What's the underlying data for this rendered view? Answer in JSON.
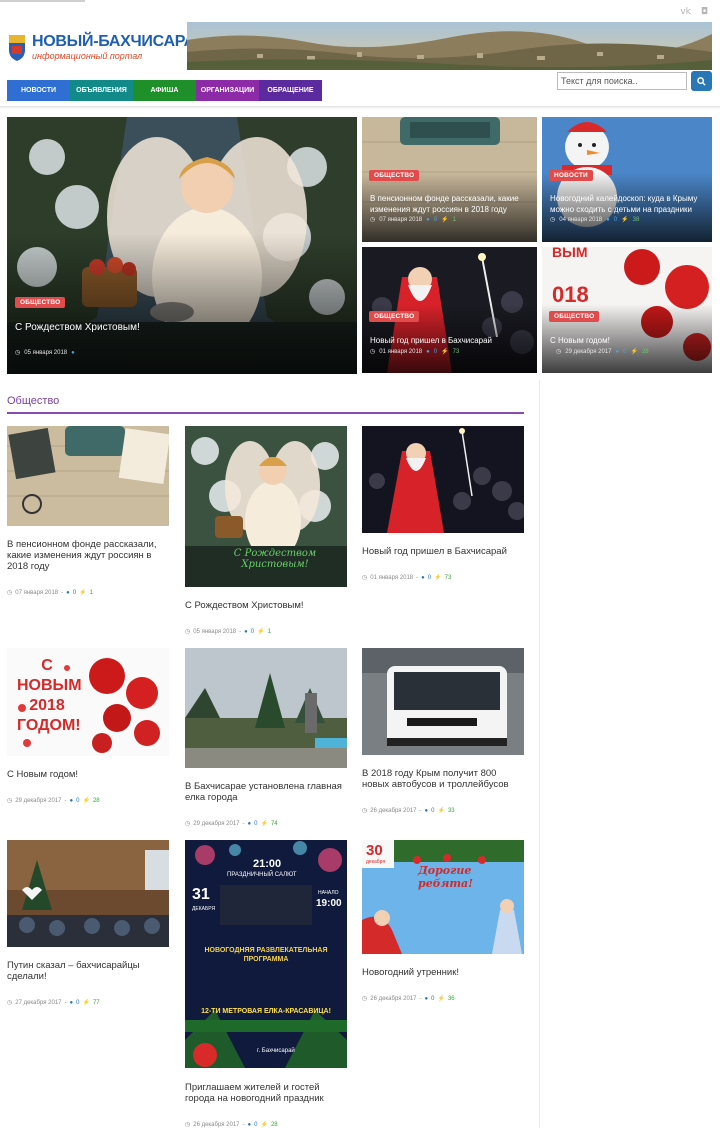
{
  "header": {
    "logo_title": "НОВЫЙ-БАХЧИСАРАЙ",
    "logo_subtitle": "информационный портал",
    "social": [
      "vk",
      "ig"
    ],
    "search_placeholder": "Текст для поиска..",
    "search_icon": "search-icon"
  },
  "nav": [
    {
      "label": "НОВОСТИ",
      "color": "#2f6ed2"
    },
    {
      "label": "ОБЪЯВЛЕНИЯ",
      "color": "#138a8a"
    },
    {
      "label": "АФИША",
      "color": "#1f8f2a"
    },
    {
      "label": "ОРГАНИЗАЦИИ",
      "color": "#8c2aa8"
    },
    {
      "label": "ОБРАЩЕНИЕ",
      "color": "#5a2a9e"
    }
  ],
  "featured": [
    {
      "badge": "ОБЩЕСТВО",
      "title": "С Рождеством Христовым!",
      "date": "05 января 2018",
      "comments": "",
      "views": ""
    },
    {
      "badge": "ОБЩЕСТВО",
      "title": "В пенсионном фонде рассказали, какие изменения ждут россиян в 2018 году",
      "date": "07 января 2018",
      "comments": "0",
      "views": "1"
    },
    {
      "badge": "НОВОСТИ",
      "title": "Новогодний калейдоскоп: куда в Крыму можно сходить с детьми на праздники",
      "date": "04 января 2018",
      "comments": "0",
      "views": "38"
    },
    {
      "badge": "ОБЩЕСТВО",
      "title": "Новый год пришел в Бахчисарай",
      "date": "01 января 2018",
      "comments": "0",
      "views": "73"
    },
    {
      "badge": "ОБЩЕСТВО",
      "title": "С Новым годом!",
      "date": "29 декабря 2017",
      "comments": "0",
      "views": "28"
    }
  ],
  "section": {
    "title": "Общество"
  },
  "cards": [
    {
      "title": "В пенсионном фонде рассказали, какие изменения ждут россиян в 2018 году",
      "date": "07 января 2018",
      "comments": "0",
      "views": "1"
    },
    {
      "title": "С Рождеством Христовым!",
      "date": "05 января 2018",
      "comments": "0",
      "views": "1",
      "thumb_text": "С Рождеством Христовым!"
    },
    {
      "title": "Новый год пришел в Бахчисарай",
      "date": "01 января 2018",
      "comments": "0",
      "views": "73"
    },
    {
      "title": "С Новым годом!",
      "date": "29 декабря 2017",
      "comments": "0",
      "views": "28",
      "thumb_text": "С НОВЫМ 2018 ГОДОМ!"
    },
    {
      "title": "В Бахчисарае установлена главная елка города",
      "date": "29 декабря 2017",
      "comments": "0",
      "views": "74"
    },
    {
      "title": "В 2018 году Крым получит 800 новых автобусов и троллейбусов",
      "date": "26 декабря 2017",
      "comments": "0",
      "views": "33"
    },
    {
      "title": "Путин сказал – бахчисарайцы сделали!",
      "date": "27 декабря 2017",
      "comments": "0",
      "views": "77"
    },
    {
      "title": "Приглашаем жителей и гостей города на новогодний праздник",
      "date": "26 декабря 2017",
      "comments": "0",
      "views": "28",
      "poster": {
        "time1": "21:00",
        "line1": "ПРАЗДНИЧНЫЙ САЛЮТ",
        "day": "31",
        "month": "ДЕКАБРЯ",
        "start": "НАЧАЛО",
        "time2": "19:00",
        "program": "НОВОГОДНЯЯ РАЗВЛЕКАТЕЛЬНАЯ ПРОГРАММА",
        "tree": "12-ТИ МЕТРОВАЯ ЕЛКА-КРАСАВИЦА!",
        "city": "г. Бахчисарай"
      }
    },
    {
      "title": "Новогодний утренник!",
      "date": "26 декабря 2017",
      "comments": "0",
      "views": "36",
      "poster": {
        "day": "30",
        "month": "декабря",
        "heading": "Дорогие ребята!"
      }
    }
  ]
}
